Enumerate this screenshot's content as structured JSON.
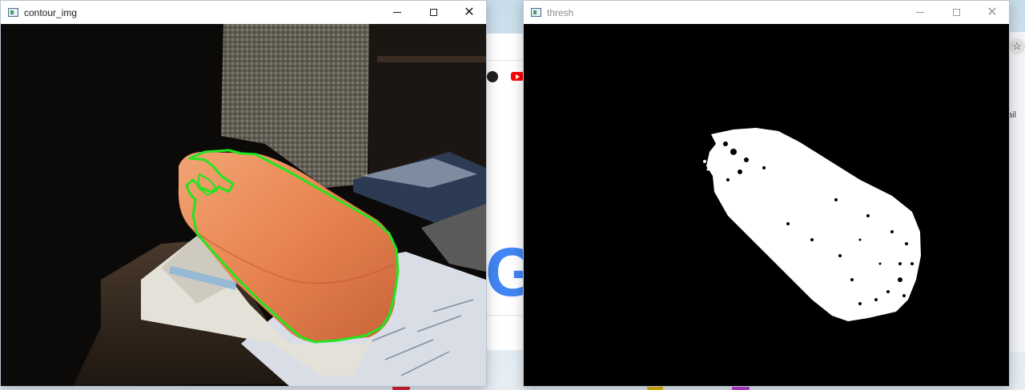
{
  "windows": {
    "contour": {
      "title": "contour_img"
    },
    "thresh": {
      "title": "thresh"
    }
  },
  "background_browser": {
    "logo_letter": "G",
    "side_text": "ail"
  },
  "icons": {
    "app": "opencv-window-icon",
    "minimize": "minimize-icon",
    "maximize": "maximize-icon",
    "close": "close-icon"
  },
  "colors": {
    "contour_line": "#22e61e",
    "object": "#e8834e",
    "thresh_white": "#ffffff",
    "thresh_bg": "#000000"
  }
}
